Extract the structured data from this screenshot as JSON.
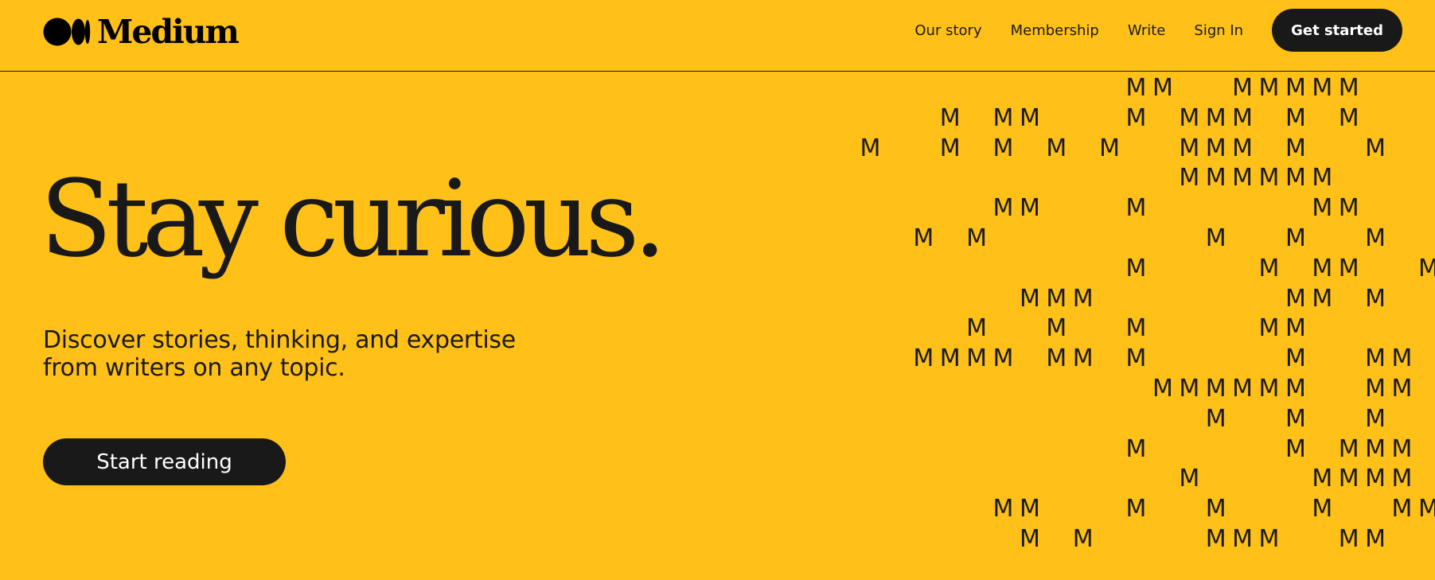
{
  "header": {
    "logo_text": "Medium",
    "nav": {
      "our_story": "Our story",
      "membership": "Membership",
      "write": "Write",
      "sign_in": "Sign In",
      "get_started": "Get started"
    }
  },
  "hero": {
    "title": "Stay curious.",
    "subtitle": "Discover stories, thinking, and expertise from writers on any topic.",
    "cta": "Start reading"
  },
  "pattern": {
    "glyph": "M",
    "rows": [
      "..........MM..MMMMM...MM",
      "...M.MM...M.MMM.M.M.....",
      "M..M.M.M.M..MMM.M..M....",
      "............MMMMMM......",
      ".....MM...M......MM.....",
      "..M.M........M..M..M....",
      "..........M....M.MM..M..",
      "......MMM.......MM.M....",
      "....M..M..M....MM.....M.",
      "..MMMM.MM.M.....M..MM...",
      "...........MMMMMM..MM...",
      ".............M..M..M....",
      "..........M.....M.MMM...",
      "............M....MMMM...",
      ".....MM...M..M...M..MM..",
      "......M.M....MMM..MM...."
    ]
  },
  "colors": {
    "background": "#FFC017",
    "ink": "#191919",
    "button_text": "#FFFFFF"
  }
}
